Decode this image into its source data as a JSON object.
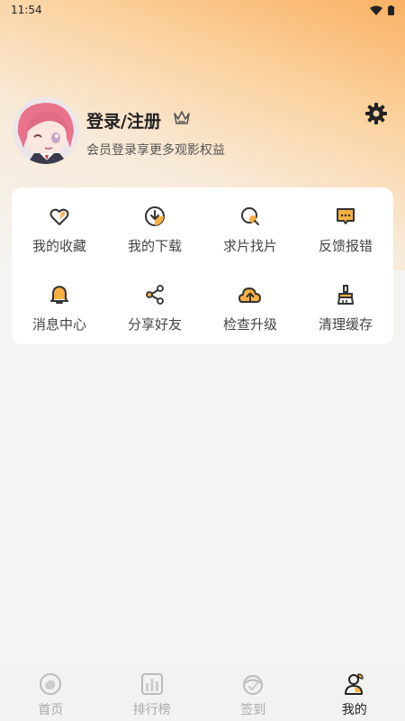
{
  "status_bar": {
    "time": "11:54"
  },
  "profile": {
    "title": "登录/注册",
    "subtitle": "会员登录享更多观影权益"
  },
  "menu": {
    "items": [
      {
        "label": "我的收藏",
        "icon": "heart-icon"
      },
      {
        "label": "我的下载",
        "icon": "download-icon"
      },
      {
        "label": "求片找片",
        "icon": "search-film-icon"
      },
      {
        "label": "反馈报错",
        "icon": "feedback-icon"
      },
      {
        "label": "消息中心",
        "icon": "bell-icon"
      },
      {
        "label": "分享好友",
        "icon": "share-icon"
      },
      {
        "label": "检查升级",
        "icon": "upgrade-icon"
      },
      {
        "label": "清理缓存",
        "icon": "clean-icon"
      }
    ]
  },
  "tabbar": {
    "tabs": [
      {
        "label": "首页",
        "icon": "home-icon"
      },
      {
        "label": "排行榜",
        "icon": "ranking-icon"
      },
      {
        "label": "签到",
        "icon": "checkin-icon"
      },
      {
        "label": "我的",
        "icon": "profile-icon"
      }
    ],
    "active": "我的"
  },
  "colors": {
    "accent": "#f9b040",
    "text": "#333333",
    "inactive": "#aaaaaa"
  }
}
